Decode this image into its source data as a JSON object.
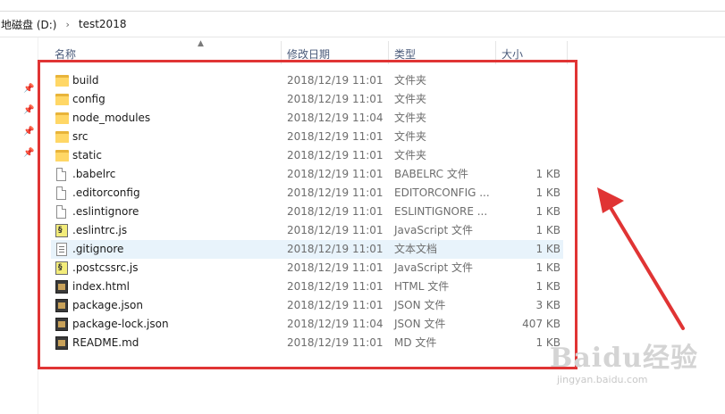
{
  "breadcrumb": {
    "drive": "地磁盘 (D:)",
    "separator": "›",
    "folder": "test2018"
  },
  "columns": {
    "name": "名称",
    "date": "修改日期",
    "type": "类型",
    "size": "大小"
  },
  "files": [
    {
      "name": "build",
      "date": "2018/12/19 11:01",
      "type": "文件夹",
      "size": "",
      "icon": "folder-icon"
    },
    {
      "name": "config",
      "date": "2018/12/19 11:01",
      "type": "文件夹",
      "size": "",
      "icon": "folder-icon"
    },
    {
      "name": "node_modules",
      "date": "2018/12/19 11:04",
      "type": "文件夹",
      "size": "",
      "icon": "folder-icon"
    },
    {
      "name": "src",
      "date": "2018/12/19 11:01",
      "type": "文件夹",
      "size": "",
      "icon": "folder-icon"
    },
    {
      "name": "static",
      "date": "2018/12/19 11:01",
      "type": "文件夹",
      "size": "",
      "icon": "folder-icon"
    },
    {
      "name": ".babelrc",
      "date": "2018/12/19 11:01",
      "type": "BABELRC 文件",
      "size": "1 KB",
      "icon": "file-icon"
    },
    {
      "name": ".editorconfig",
      "date": "2018/12/19 11:01",
      "type": "EDITORCONFIG ...",
      "size": "1 KB",
      "icon": "file-icon"
    },
    {
      "name": ".eslintignore",
      "date": "2018/12/19 11:01",
      "type": "ESLINTIGNORE ...",
      "size": "1 KB",
      "icon": "file-icon"
    },
    {
      "name": ".eslintrc.js",
      "date": "2018/12/19 11:01",
      "type": "JavaScript 文件",
      "size": "1 KB",
      "icon": "js-file-icon"
    },
    {
      "name": ".gitignore",
      "date": "2018/12/19 11:01",
      "type": "文本文档",
      "size": "1 KB",
      "icon": "text-file-icon"
    },
    {
      "name": ".postcssrc.js",
      "date": "2018/12/19 11:01",
      "type": "JavaScript 文件",
      "size": "1 KB",
      "icon": "js-file-icon"
    },
    {
      "name": "index.html",
      "date": "2018/12/19 11:01",
      "type": "HTML 文件",
      "size": "1 KB",
      "icon": "html-file-icon"
    },
    {
      "name": "package.json",
      "date": "2018/12/19 11:01",
      "type": "JSON 文件",
      "size": "3 KB",
      "icon": "json-file-icon"
    },
    {
      "name": "package-lock.json",
      "date": "2018/12/19 11:04",
      "type": "JSON 文件",
      "size": "407 KB",
      "icon": "json-file-icon"
    },
    {
      "name": "README.md",
      "date": "2018/12/19 11:01",
      "type": "MD 文件",
      "size": "1 KB",
      "icon": "md-file-icon"
    }
  ],
  "highlighted_row": ".gitignore",
  "watermark": {
    "brand": "Baidu经验",
    "url": "jingyan.baidu.com"
  },
  "colors": {
    "annotation": "#e03434",
    "folder": "#ffd766",
    "row_highlight": "#e8f3fb"
  }
}
